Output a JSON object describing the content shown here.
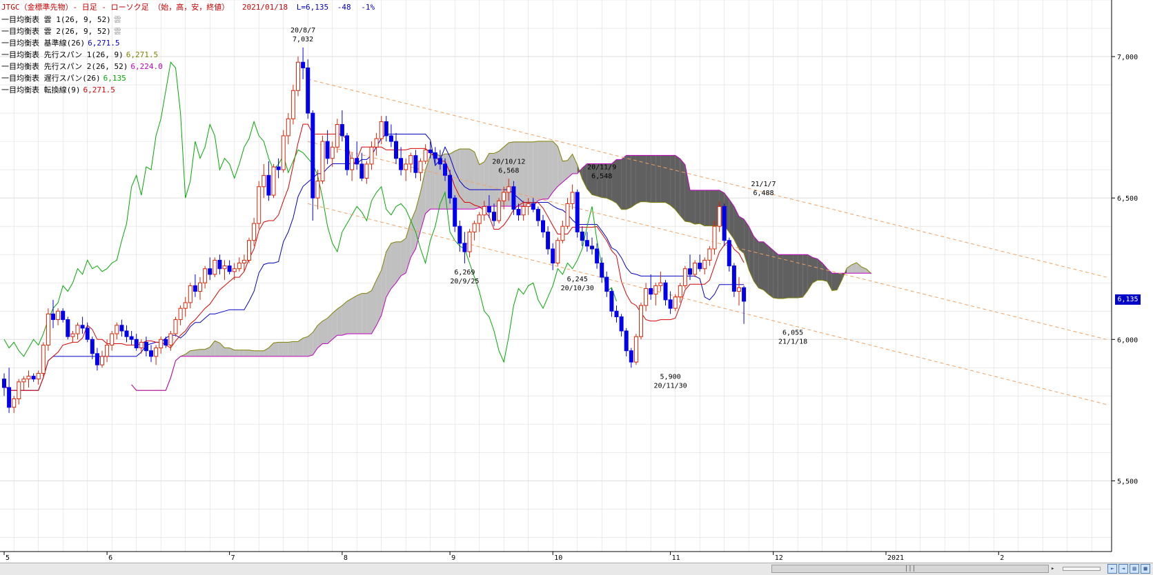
{
  "title": {
    "instrument": "JTGC（金標準先物）- 日足 - ローソク足 （始，高，安，終値）",
    "date": "2021/01/18",
    "last": "L=6,135",
    "change": "-48",
    "pct": "-1%"
  },
  "legend": [
    {
      "label": "一目均衡表 雲 1(26, 9, 52)",
      "value": "雲",
      "color": "#a0a0a0"
    },
    {
      "label": "一目均衡表 雲 2(26, 9, 52)",
      "value": "雲",
      "color": "#a0a0a0"
    },
    {
      "label": "一目均衡表 基準線(26)",
      "value": "6,271.5",
      "color": "#0000cc"
    },
    {
      "label": "一目均衡表 先行スパン 1(26, 9)",
      "value": "6,271.5",
      "color": "#808000"
    },
    {
      "label": "一目均衡表 先行スパン 2(26, 52)",
      "value": "6,224.0",
      "color": "#c000c0"
    },
    {
      "label": "一目均衡表 遅行スパン(26)",
      "value": "6,135",
      "color": "#00aa00"
    },
    {
      "label": "一目均衡表 転換線(9)",
      "value": "6,271.5",
      "color": "#dd0000"
    }
  ],
  "colors": {
    "up_candle": "#dd2200",
    "down_candle": "#0000ee",
    "kijun": "#0000cc",
    "tenkan": "#dd0000",
    "chikou": "#00aa00",
    "senkou_a": "#808000",
    "senkou_b": "#c000c0",
    "cloud_bull": "#c0c0c0",
    "cloud_bear": "#606060",
    "trend": "#f0a060",
    "grid": "#dddddd"
  },
  "last_price_badge": "6,135",
  "scroll_thumb_text": "|||",
  "chart_data": {
    "type": "candlestick",
    "ylim": [
      5250,
      7200
    ],
    "y_ticks": [
      5500,
      6000,
      6500,
      7000
    ],
    "y_tick_labels": [
      "5,500",
      "6,000",
      "6,500",
      "7,000"
    ],
    "x_month_labels": [
      {
        "label": "5",
        "bar": 0
      },
      {
        "label": "6",
        "bar": 21
      },
      {
        "label": "7",
        "bar": 46
      },
      {
        "label": "8",
        "bar": 69
      },
      {
        "label": "9",
        "bar": 91
      },
      {
        "label": "10",
        "bar": 112
      },
      {
        "label": "11",
        "bar": 136
      },
      {
        "label": "12",
        "bar": 157
      },
      {
        "label": "2021",
        "bar": 180
      },
      {
        "label": "2",
        "bar": 203
      }
    ],
    "candles": [
      [
        5860,
        5880,
        5800,
        5830
      ],
      [
        5830,
        5900,
        5740,
        5760
      ],
      [
        5760,
        5800,
        5740,
        5790
      ],
      [
        5790,
        5860,
        5770,
        5850
      ],
      [
        5850,
        5870,
        5820,
        5860
      ],
      [
        5860,
        5890,
        5830,
        5870
      ],
      [
        5870,
        5880,
        5850,
        5860
      ],
      [
        5860,
        5890,
        5840,
        5880
      ],
      [
        5880,
        5990,
        5870,
        5980
      ],
      [
        5980,
        6110,
        5960,
        6090
      ],
      [
        6090,
        6140,
        6040,
        6070
      ],
      [
        6070,
        6110,
        6050,
        6100
      ],
      [
        6100,
        6110,
        6060,
        6070
      ],
      [
        6070,
        6080,
        6000,
        6010
      ],
      [
        6010,
        6030,
        5990,
        6020
      ],
      [
        6020,
        6060,
        6000,
        6050
      ],
      [
        6050,
        6080,
        6020,
        6040
      ],
      [
        6040,
        6060,
        5990,
        6000
      ],
      [
        6000,
        6010,
        5930,
        5950
      ],
      [
        5950,
        5970,
        5890,
        5910
      ],
      [
        5910,
        5960,
        5900,
        5940
      ],
      [
        5940,
        6000,
        5920,
        5980
      ],
      [
        5980,
        6030,
        5960,
        6020
      ],
      [
        6020,
        6060,
        6000,
        6050
      ],
      [
        6050,
        6070,
        6010,
        6030
      ],
      [
        6030,
        6050,
        5990,
        6010
      ],
      [
        6010,
        6030,
        5980,
        6000
      ],
      [
        6000,
        6020,
        5960,
        5970
      ],
      [
        5970,
        6000,
        5950,
        5990
      ],
      [
        5990,
        6010,
        5940,
        5960
      ],
      [
        5960,
        5980,
        5920,
        5940
      ],
      [
        5940,
        5980,
        5910,
        5970
      ],
      [
        5970,
        6010,
        5950,
        6000
      ],
      [
        6000,
        6010,
        5970,
        5980
      ],
      [
        5980,
        6030,
        5960,
        6020
      ],
      [
        6020,
        6080,
        6010,
        6070
      ],
      [
        6070,
        6120,
        6050,
        6110
      ],
      [
        6110,
        6150,
        6080,
        6130
      ],
      [
        6130,
        6200,
        6110,
        6190
      ],
      [
        6190,
        6230,
        6150,
        6170
      ],
      [
        6170,
        6220,
        6140,
        6200
      ],
      [
        6200,
        6260,
        6180,
        6250
      ],
      [
        6250,
        6290,
        6210,
        6230
      ],
      [
        6230,
        6290,
        6220,
        6280
      ],
      [
        6280,
        6300,
        6230,
        6250
      ],
      [
        6250,
        6280,
        6210,
        6260
      ],
      [
        6260,
        6280,
        6230,
        6240
      ],
      [
        6240,
        6270,
        6210,
        6250
      ],
      [
        6250,
        6290,
        6240,
        6270
      ],
      [
        6270,
        6300,
        6240,
        6280
      ],
      [
        6280,
        6360,
        6270,
        6350
      ],
      [
        6350,
        6430,
        6330,
        6410
      ],
      [
        6410,
        6560,
        6390,
        6540
      ],
      [
        6540,
        6620,
        6500,
        6580
      ],
      [
        6580,
        6630,
        6490,
        6510
      ],
      [
        6510,
        6620,
        6500,
        6610
      ],
      [
        6610,
        6640,
        6570,
        6600
      ],
      [
        6600,
        6740,
        6590,
        6720
      ],
      [
        6720,
        6800,
        6690,
        6780
      ],
      [
        6780,
        6900,
        6760,
        6880
      ],
      [
        6880,
        7000,
        6860,
        6980
      ],
      [
        6980,
        7032,
        6920,
        6960
      ],
      [
        6960,
        6990,
        6780,
        6800
      ],
      [
        6800,
        6810,
        6420,
        6500
      ],
      [
        6500,
        6600,
        6460,
        6560
      ],
      [
        6560,
        6720,
        6550,
        6700
      ],
      [
        6700,
        6740,
        6620,
        6640
      ],
      [
        6640,
        6700,
        6610,
        6680
      ],
      [
        6680,
        6780,
        6660,
        6760
      ],
      [
        6760,
        6810,
        6700,
        6720
      ],
      [
        6720,
        6730,
        6580,
        6600
      ],
      [
        6600,
        6660,
        6560,
        6640
      ],
      [
        6640,
        6700,
        6600,
        6620
      ],
      [
        6620,
        6660,
        6560,
        6570
      ],
      [
        6570,
        6630,
        6550,
        6620
      ],
      [
        6620,
        6700,
        6600,
        6680
      ],
      [
        6680,
        6730,
        6650,
        6710
      ],
      [
        6710,
        6790,
        6690,
        6770
      ],
      [
        6770,
        6790,
        6700,
        6720
      ],
      [
        6720,
        6760,
        6680,
        6700
      ],
      [
        6700,
        6730,
        6620,
        6640
      ],
      [
        6640,
        6680,
        6580,
        6600
      ],
      [
        6600,
        6640,
        6560,
        6620
      ],
      [
        6620,
        6660,
        6590,
        6650
      ],
      [
        6650,
        6670,
        6570,
        6590
      ],
      [
        6590,
        6640,
        6560,
        6630
      ],
      [
        6630,
        6690,
        6620,
        6670
      ],
      [
        6670,
        6700,
        6640,
        6660
      ],
      [
        6660,
        6680,
        6620,
        6640
      ],
      [
        6640,
        6670,
        6600,
        6620
      ],
      [
        6620,
        6640,
        6560,
        6580
      ],
      [
        6580,
        6600,
        6480,
        6500
      ],
      [
        6500,
        6510,
        6380,
        6400
      ],
      [
        6400,
        6420,
        6310,
        6340
      ],
      [
        6340,
        6380,
        6269,
        6310
      ],
      [
        6310,
        6390,
        6290,
        6380
      ],
      [
        6380,
        6420,
        6350,
        6410
      ],
      [
        6410,
        6450,
        6380,
        6440
      ],
      [
        6440,
        6490,
        6420,
        6470
      ],
      [
        6470,
        6510,
        6430,
        6450
      ],
      [
        6450,
        6480,
        6400,
        6420
      ],
      [
        6420,
        6500,
        6410,
        6490
      ],
      [
        6490,
        6540,
        6460,
        6520
      ],
      [
        6520,
        6568,
        6490,
        6540
      ],
      [
        6540,
        6560,
        6440,
        6460
      ],
      [
        6460,
        6480,
        6420,
        6440
      ],
      [
        6440,
        6490,
        6420,
        6470
      ],
      [
        6470,
        6500,
        6440,
        6480
      ],
      [
        6480,
        6500,
        6450,
        6460
      ],
      [
        6460,
        6470,
        6400,
        6420
      ],
      [
        6420,
        6440,
        6360,
        6380
      ],
      [
        6380,
        6400,
        6300,
        6320
      ],
      [
        6320,
        6340,
        6245,
        6270
      ],
      [
        6270,
        6360,
        6260,
        6350
      ],
      [
        6350,
        6420,
        6340,
        6400
      ],
      [
        6400,
        6500,
        6390,
        6480
      ],
      [
        6480,
        6548,
        6460,
        6520
      ],
      [
        6520,
        6530,
        6360,
        6380
      ],
      [
        6380,
        6400,
        6330,
        6350
      ],
      [
        6350,
        6380,
        6310,
        6330
      ],
      [
        6330,
        6360,
        6300,
        6320
      ],
      [
        6320,
        6340,
        6250,
        6270
      ],
      [
        6270,
        6290,
        6200,
        6220
      ],
      [
        6220,
        6240,
        6150,
        6170
      ],
      [
        6170,
        6180,
        6080,
        6100
      ],
      [
        6100,
        6120,
        6060,
        6080
      ],
      [
        6080,
        6090,
        6010,
        6030
      ],
      [
        6030,
        6040,
        5940,
        5960
      ],
      [
        5960,
        5970,
        5900,
        5920
      ],
      [
        5920,
        6020,
        5910,
        6010
      ],
      [
        6010,
        6130,
        6000,
        6120
      ],
      [
        6120,
        6200,
        6100,
        6180
      ],
      [
        6180,
        6230,
        6140,
        6160
      ],
      [
        6160,
        6200,
        6120,
        6190
      ],
      [
        6190,
        6240,
        6170,
        6200
      ],
      [
        6200,
        6210,
        6120,
        6140
      ],
      [
        6140,
        6170,
        6090,
        6110
      ],
      [
        6110,
        6160,
        6100,
        6150
      ],
      [
        6150,
        6200,
        6130,
        6190
      ],
      [
        6190,
        6260,
        6180,
        6250
      ],
      [
        6250,
        6300,
        6210,
        6230
      ],
      [
        6230,
        6280,
        6220,
        6270
      ],
      [
        6270,
        6300,
        6240,
        6250
      ],
      [
        6250,
        6290,
        6230,
        6280
      ],
      [
        6280,
        6330,
        6260,
        6320
      ],
      [
        6320,
        6420,
        6300,
        6400
      ],
      [
        6400,
        6488,
        6380,
        6470
      ],
      [
        6470,
        6480,
        6330,
        6350
      ],
      [
        6350,
        6360,
        6240,
        6260
      ],
      [
        6260,
        6270,
        6150,
        6170
      ],
      [
        6170,
        6220,
        6120,
        6183
      ],
      [
        6183,
        6190,
        6055,
        6135
      ]
    ],
    "kijun": [],
    "chikou_path_note": "",
    "peak_labels": [
      {
        "bar": 61,
        "price": 7032,
        "date": "20/8/7",
        "value": "7,032",
        "pos": "above"
      },
      {
        "bar": 94,
        "price": 6269,
        "date": "20/9/25",
        "value": "6,269",
        "pos": "below"
      },
      {
        "bar": 103,
        "price": 6568,
        "date": "20/10/12",
        "value": "6,568",
        "pos": "above"
      },
      {
        "bar": 117,
        "price": 6245,
        "date": "20/10/30",
        "value": "6,245",
        "pos": "below"
      },
      {
        "bar": 122,
        "price": 6548,
        "date": "20/11/9",
        "value": "6,548",
        "pos": "above"
      },
      {
        "bar": 136,
        "price": 5900,
        "date": "20/11/30",
        "value": "5,900",
        "pos": "below"
      },
      {
        "bar": 155,
        "price": 6488,
        "date": "21/1/7",
        "value": "6,488",
        "pos": "above"
      },
      {
        "bar": 161,
        "price": 6055,
        "date": "21/1/18",
        "value": "6,055",
        "pos": "below"
      }
    ],
    "trend_lines": [
      {
        "from_bar": 62,
        "from_price": 6920,
        "to_bar": 225,
        "to_price": 6220
      },
      {
        "from_bar": 62,
        "from_price": 6700,
        "to_bar": 225,
        "to_price": 6000
      },
      {
        "from_bar": 62,
        "from_price": 6480,
        "to_bar": 225,
        "to_price": 5770
      }
    ]
  }
}
